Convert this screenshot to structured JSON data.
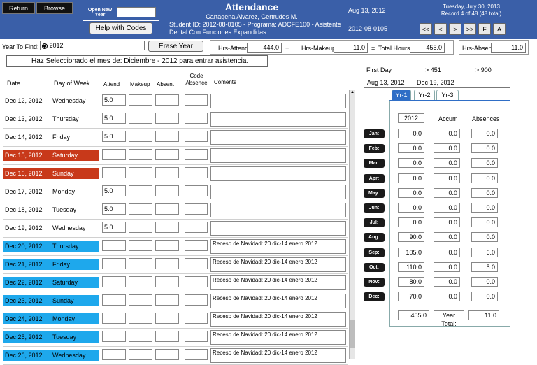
{
  "header": {
    "return_label": "Return",
    "browse_label": "Browse",
    "open_new_year_label": "Open New Year",
    "open_new_year_value": "",
    "help_codes_label": "Help with Codes",
    "title": "Attendance",
    "student_name": "Cartagena Alvarez, Gertrudes M.",
    "student_line": "Student ID: 2012-08-0105 -  Programa: ADCFE100 - Asistente",
    "program_line": "Dental Con Funciones Expandidas",
    "date_center": "Aug 13, 2012",
    "student_id_right": "2012-08-0105",
    "today": "Tuesday, July 30, 2013",
    "record": "Record 4 of 48 (48 total)",
    "nav": [
      "<<",
      "<",
      ">",
      ">>",
      "F",
      "A"
    ]
  },
  "toolbar": {
    "year_to_find_label": "Year To Find:",
    "year_value": "2012",
    "erase_year_label": "Erase Year",
    "hrs_attend_label": "Hrs-Attend:",
    "hrs_attend_value": "444.0",
    "plus": "+",
    "hrs_makeup_label": "Hrs-Makeup:",
    "hrs_makeup_value": "11.0",
    "equals": "=",
    "total_hours_label": "Total Hours:",
    "total_hours_value": "455.0",
    "hrs_absent_label": "Hrs-Absent:",
    "hrs_absent_value": "11.0"
  },
  "message": "Haz Seleccionado el mes de: Diciembre - 2012 para entrar asistencia.",
  "columns": {
    "date": "Date",
    "day": "Day of Week",
    "attend": "Attend",
    "makeup": "Makeup",
    "absent": "Absent",
    "code_absence": "Code Absence",
    "comments": "Coments"
  },
  "rows": [
    {
      "date": "Dec 12, 2012",
      "day": "Wednesday",
      "attend": "5.0",
      "comment": "",
      "style": "white"
    },
    {
      "date": "Dec 13, 2012",
      "day": "Thursday",
      "attend": "5.0",
      "comment": "",
      "style": "white"
    },
    {
      "date": "Dec 14, 2012",
      "day": "Friday",
      "attend": "5.0",
      "comment": "",
      "style": "white"
    },
    {
      "date": "Dec 15, 2012",
      "day": "Saturday",
      "attend": "",
      "comment": "",
      "style": "red"
    },
    {
      "date": "Dec 16, 2012",
      "day": "Sunday",
      "attend": "",
      "comment": "",
      "style": "red"
    },
    {
      "date": "Dec 17, 2012",
      "day": "Monday",
      "attend": "5.0",
      "comment": "",
      "style": "white"
    },
    {
      "date": "Dec 18, 2012",
      "day": "Tuesday",
      "attend": "5.0",
      "comment": "",
      "style": "white"
    },
    {
      "date": "Dec 19, 2012",
      "day": "Wednesday",
      "attend": "5.0",
      "comment": "",
      "style": "white"
    },
    {
      "date": "Dec 20, 2012",
      "day": "Thursday",
      "attend": "",
      "comment": "Receso de Navidad: 20 dic-14 enero 2012",
      "style": "blue"
    },
    {
      "date": "Dec 21, 2012",
      "day": "Friday",
      "attend": "",
      "comment": "Receso de Navidad: 20 dic-14 enero 2012",
      "style": "blue"
    },
    {
      "date": "Dec 22, 2012",
      "day": "Saturday",
      "attend": "",
      "comment": "Receso de Navidad: 20 dic-14 enero 2012",
      "style": "blue"
    },
    {
      "date": "Dec 23, 2012",
      "day": "Sunday",
      "attend": "",
      "comment": "Receso de Navidad: 20 dic-14 enero 2012",
      "style": "blue"
    },
    {
      "date": "Dec 24, 2012",
      "day": "Monday",
      "attend": "",
      "comment": "Receso de Navidad: 20 dic-14 enero 2012",
      "style": "blue"
    },
    {
      "date": "Dec 25, 2012",
      "day": "Tuesday",
      "attend": "",
      "comment": "Receso de Navidad: 20 dic-14 enero 2012",
      "style": "blue"
    },
    {
      "date": "Dec 26, 2012",
      "day": "Wednesday",
      "attend": "",
      "comment": "Receso de Navidad: 20 dic-14 enero 2012",
      "style": "blue"
    }
  ],
  "side": {
    "first_day_label": "First Day",
    "gt451_label": "> 451",
    "gt900_label": "> 900",
    "first_day_value": "Aug 13, 2012",
    "gt451_value": "Dec 19, 2012",
    "tabs": [
      "Yr-1",
      "Yr-2",
      "Yr-3"
    ],
    "year_col": "2012",
    "accum_col": "Accum",
    "absences_col": "Absences",
    "months": [
      {
        "label": "Jan:",
        "hours": "0.0",
        "accum": "0.0",
        "abs": "0.0"
      },
      {
        "label": "Feb:",
        "hours": "0.0",
        "accum": "0.0",
        "abs": "0.0"
      },
      {
        "label": "Mar:",
        "hours": "0.0",
        "accum": "0.0",
        "abs": "0.0"
      },
      {
        "label": "Apr:",
        "hours": "0.0",
        "accum": "0.0",
        "abs": "0.0"
      },
      {
        "label": "May:",
        "hours": "0.0",
        "accum": "0.0",
        "abs": "0.0"
      },
      {
        "label": "Jun:",
        "hours": "0.0",
        "accum": "0.0",
        "abs": "0.0"
      },
      {
        "label": "Jul:",
        "hours": "0.0",
        "accum": "0.0",
        "abs": "0.0"
      },
      {
        "label": "Aug:",
        "hours": "90.0",
        "accum": "0.0",
        "abs": "0.0"
      },
      {
        "label": "Sep:",
        "hours": "105.0",
        "accum": "0.0",
        "abs": "6.0"
      },
      {
        "label": "Oct:",
        "hours": "110.0",
        "accum": "0.0",
        "abs": "5.0"
      },
      {
        "label": "Nov:",
        "hours": "80.0",
        "accum": "0.0",
        "abs": "0.0"
      },
      {
        "label": "Dec:",
        "hours": "70.0",
        "accum": "0.0",
        "abs": "0.0"
      }
    ],
    "total_hours": "455.0",
    "year_total_label": "Year Total:",
    "year_total_abs": "11.0"
  },
  "colors": {
    "header": "#3a5fa8",
    "weekend": "#c8391a",
    "holiday": "#1ea8ec"
  }
}
